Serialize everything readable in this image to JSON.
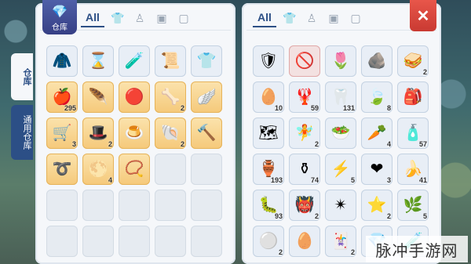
{
  "left_panel": {
    "badge_label": "仓库",
    "tabs": [
      {
        "name": "all",
        "label": "All"
      },
      {
        "name": "equipment",
        "icon": "shirt-icon",
        "glyph": "👕"
      },
      {
        "name": "costume",
        "icon": "figure-icon",
        "glyph": "♙"
      },
      {
        "name": "card",
        "icon": "card-icon",
        "glyph": "▣"
      },
      {
        "name": "misc",
        "icon": "frame-icon",
        "glyph": "▢"
      }
    ],
    "slots": [
      {
        "icon": "cape-icon",
        "glyph": "🧥",
        "count": "",
        "style": "filled"
      },
      {
        "icon": "hourglass-icon",
        "glyph": "⌛",
        "count": "",
        "style": "filled"
      },
      {
        "icon": "pink-potion-icon",
        "glyph": "🧪",
        "count": "",
        "style": "filled"
      },
      {
        "icon": "scroll-icon",
        "glyph": "📜",
        "count": "",
        "style": "filled"
      },
      {
        "icon": "leather-shirt-icon",
        "glyph": "👕",
        "count": "",
        "style": "filled"
      },
      {
        "icon": "apple-icon",
        "glyph": "🍎",
        "count": "295",
        "style": "gold"
      },
      {
        "icon": "feather-icon",
        "glyph": "🪶",
        "count": "",
        "style": "gold"
      },
      {
        "icon": "poring-icon",
        "glyph": "🔴",
        "count": "",
        "style": "gold"
      },
      {
        "icon": "bone-icon",
        "glyph": "🦴",
        "count": "2",
        "style": "gold"
      },
      {
        "icon": "wing-icon",
        "glyph": "🪽",
        "count": "",
        "style": "gold"
      },
      {
        "icon": "wagon-icon",
        "glyph": "🛒",
        "count": "3",
        "style": "gold"
      },
      {
        "icon": "witch-hat-icon",
        "glyph": "🎩",
        "count": "2",
        "style": "gold"
      },
      {
        "icon": "jelly-icon",
        "glyph": "🍮",
        "count": "",
        "style": "gold"
      },
      {
        "icon": "horn-icon",
        "glyph": "🐚",
        "count": "2",
        "style": "gold"
      },
      {
        "icon": "hammer-icon",
        "glyph": "🔨",
        "count": "",
        "style": "gold"
      },
      {
        "icon": "ring-icon",
        "glyph": "➰",
        "count": "",
        "style": "gold"
      },
      {
        "icon": "pearl-icon",
        "glyph": "🌕",
        "count": "4",
        "style": "gold"
      },
      {
        "icon": "necklace-icon",
        "glyph": "📿",
        "count": "",
        "style": "gold"
      },
      {
        "style": "empty"
      },
      {
        "style": "empty"
      },
      {
        "style": "empty"
      },
      {
        "style": "empty"
      },
      {
        "style": "empty"
      },
      {
        "style": "empty"
      },
      {
        "style": "empty"
      },
      {
        "style": "empty"
      },
      {
        "style": "empty"
      },
      {
        "style": "empty"
      },
      {
        "style": "empty"
      },
      {
        "style": "empty"
      }
    ]
  },
  "side_tabs": [
    {
      "label": "仓库",
      "active": true
    },
    {
      "label": "通用仓库",
      "active": false
    }
  ],
  "right_panel": {
    "tabs": [
      {
        "name": "all",
        "label": "All"
      },
      {
        "name": "equipment",
        "icon": "shirt-icon",
        "glyph": "👕"
      },
      {
        "name": "costume",
        "icon": "figure-icon",
        "glyph": "♙"
      },
      {
        "name": "card",
        "icon": "card-icon",
        "glyph": "▣"
      },
      {
        "name": "misc",
        "icon": "frame-icon",
        "glyph": "▢"
      }
    ],
    "close_label": "✕",
    "slots": [
      {
        "icon": "armor-icon",
        "glyph": "🛡",
        "count": "",
        "style": "filled"
      },
      {
        "icon": "disabled-item-icon",
        "glyph": "🚫",
        "count": "",
        "style": "red"
      },
      {
        "icon": "flower-icon",
        "glyph": "🌷",
        "count": "",
        "style": "filled"
      },
      {
        "icon": "stone-icon",
        "glyph": "🪨",
        "count": "",
        "style": "filled"
      },
      {
        "icon": "sandwich-icon",
        "glyph": "🥪",
        "count": "2",
        "style": "filled"
      },
      {
        "icon": "egg-icon",
        "glyph": "🥚",
        "count": "10",
        "style": "filled"
      },
      {
        "icon": "claw-icon",
        "glyph": "🦞",
        "count": "59",
        "style": "filled"
      },
      {
        "icon": "fang-icon",
        "glyph": "🦷",
        "count": "131",
        "style": "filled"
      },
      {
        "icon": "leaf-icon",
        "glyph": "🍃",
        "count": "8",
        "style": "filled"
      },
      {
        "icon": "backpack-icon",
        "glyph": "🎒",
        "count": "",
        "style": "filled"
      },
      {
        "icon": "map-icon",
        "glyph": "🗺",
        "count": "",
        "style": "filled"
      },
      {
        "icon": "fairy-icon",
        "glyph": "🧚",
        "count": "2",
        "style": "filled"
      },
      {
        "icon": "salad-icon",
        "glyph": "🥗",
        "count": "",
        "style": "filled"
      },
      {
        "icon": "vegetables-icon",
        "glyph": "🥕",
        "count": "4",
        "style": "filled"
      },
      {
        "icon": "green-potion-icon",
        "glyph": "🧴",
        "count": "57",
        "style": "filled"
      },
      {
        "icon": "jar-icon",
        "glyph": "🏺",
        "count": "193",
        "style": "filled"
      },
      {
        "icon": "vase-icon",
        "glyph": "⚱",
        "count": "74",
        "style": "filled"
      },
      {
        "icon": "lightning-icon",
        "glyph": "⚡",
        "count": "5",
        "style": "filled"
      },
      {
        "icon": "heart-icon",
        "glyph": "❤",
        "count": "3",
        "style": "filled"
      },
      {
        "icon": "banana-icon",
        "glyph": "🍌",
        "count": "41",
        "style": "filled"
      },
      {
        "icon": "worm-icon",
        "glyph": "🐛",
        "count": "93",
        "style": "filled"
      },
      {
        "icon": "monster-card-icon",
        "glyph": "👹",
        "count": "2",
        "style": "filled"
      },
      {
        "icon": "purple-star-icon",
        "glyph": "✴",
        "count": "",
        "style": "filled"
      },
      {
        "icon": "star-card-icon",
        "glyph": "⭐",
        "count": "2",
        "style": "filled"
      },
      {
        "icon": "branch-icon",
        "glyph": "🌿",
        "count": "5",
        "style": "filled"
      },
      {
        "icon": "grey-stone-icon",
        "glyph": "⚪",
        "count": "2",
        "style": "filled"
      },
      {
        "icon": "white-stone-icon",
        "glyph": "🥚",
        "count": "",
        "style": "filled"
      },
      {
        "icon": "rune-card-icon",
        "glyph": "🃏",
        "count": "2",
        "style": "filled"
      },
      {
        "icon": "blue-gem-icon",
        "glyph": "💎",
        "count": "",
        "style": "filled"
      },
      {
        "icon": "red-potion-icon",
        "glyph": "🧪",
        "count": "",
        "style": "filled"
      }
    ]
  },
  "watermark": "脉冲手游网"
}
